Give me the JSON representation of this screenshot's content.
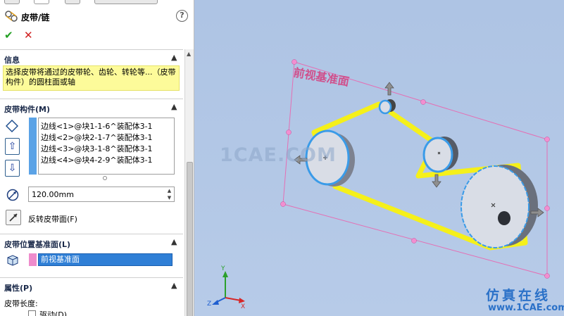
{
  "feature": {
    "title": "皮带/链",
    "help_glyph": "?",
    "ok_glyph": "✔",
    "cancel_glyph": "✕"
  },
  "info": {
    "header": "信息",
    "message": "选择皮带将通过的皮带轮、齿轮、转轮等...（皮带构件）的圆柱面或轴"
  },
  "members": {
    "header": "皮带构件(M)",
    "items": [
      "边线<1>@块1-1-6^装配体3-1",
      "边线<2>@块2-1-7^装配体3-1",
      "边线<3>@块3-1-8^装配体3-1",
      "边线<4>@块4-2-9^装配体3-1"
    ],
    "diameter_value": "120.00mm",
    "reverse_label": "反转皮带面(F)"
  },
  "position": {
    "header": "皮带位置基准面(L)",
    "plane_value": "前视基准面"
  },
  "properties": {
    "header": "属性(P)",
    "length_label": "皮带长度:",
    "drive_label": "驱动(D)"
  },
  "viewport": {
    "plane_label": "前视基准面",
    "watermark": "1CAE.COM",
    "brand_cn": "仿真在线",
    "brand_url": "www.1CAE.com",
    "axis_y": "Y",
    "axis_x": "X",
    "axis_z": "Z"
  },
  "colors": {
    "belt": "#f5f01a",
    "plane_outline": "#e46fb4",
    "selection": "#3a9be8",
    "pulley": "#d9dde6",
    "info_bg": "#fdfb9a"
  }
}
